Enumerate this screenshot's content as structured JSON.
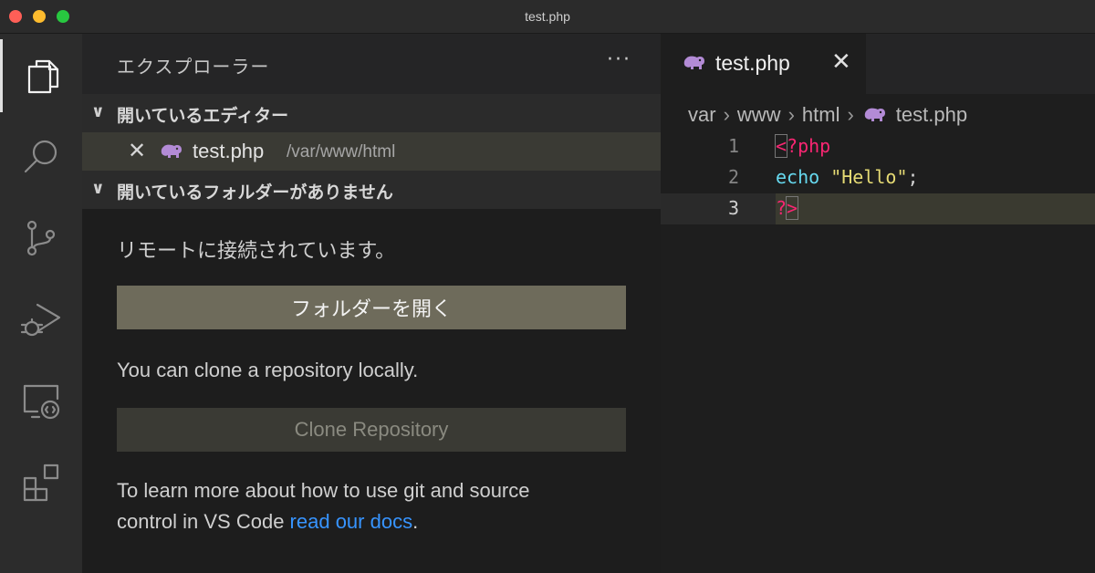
{
  "window": {
    "title": "test.php"
  },
  "activity_bar": {
    "items": [
      {
        "name": "explorer-icon",
        "active": true
      },
      {
        "name": "search-icon",
        "active": false
      },
      {
        "name": "source-control-icon",
        "active": false
      },
      {
        "name": "run-debug-icon",
        "active": false
      },
      {
        "name": "remote-explorer-icon",
        "active": false
      },
      {
        "name": "extensions-icon",
        "active": false
      }
    ]
  },
  "sidebar": {
    "title": "エクスプローラー",
    "more": "···",
    "open_editors": {
      "label": "開いているエディター",
      "items": [
        {
          "close": "✕",
          "icon": "php-elephant-icon",
          "name": "test.php",
          "path": "/var/www/html"
        }
      ]
    },
    "no_folder": {
      "label": "開いているフォルダーがありません",
      "remote_msg": "リモートに接続されています。",
      "open_folder": "フォルダーを開く",
      "clone_msg": "You can clone a repository locally.",
      "clone_button": "Clone Repository",
      "learn_line1": "To learn more about how to use git and source",
      "learn_line2_pre": "control in VS Code ",
      "learn_link": "read our docs",
      "learn_end": "."
    }
  },
  "editor": {
    "tab": {
      "name": "test.php",
      "close": "✕"
    },
    "breadcrumbs": [
      "var",
      "www",
      "html",
      "test.php"
    ],
    "lines": [
      {
        "num": "1",
        "open_bracket": "<",
        "tag": "?php"
      },
      {
        "num": "2",
        "keyword": "echo",
        "space": " ",
        "string": "\"Hello\"",
        "end": ";"
      },
      {
        "num": "3",
        "tag": "?",
        "close_bracket": ">"
      }
    ]
  },
  "colors": {
    "accent_link": "#3794ff",
    "php_tag": "#f92672",
    "string": "#e6db74",
    "keyword": "#66d9ef",
    "elephant": "#b38bd6"
  }
}
